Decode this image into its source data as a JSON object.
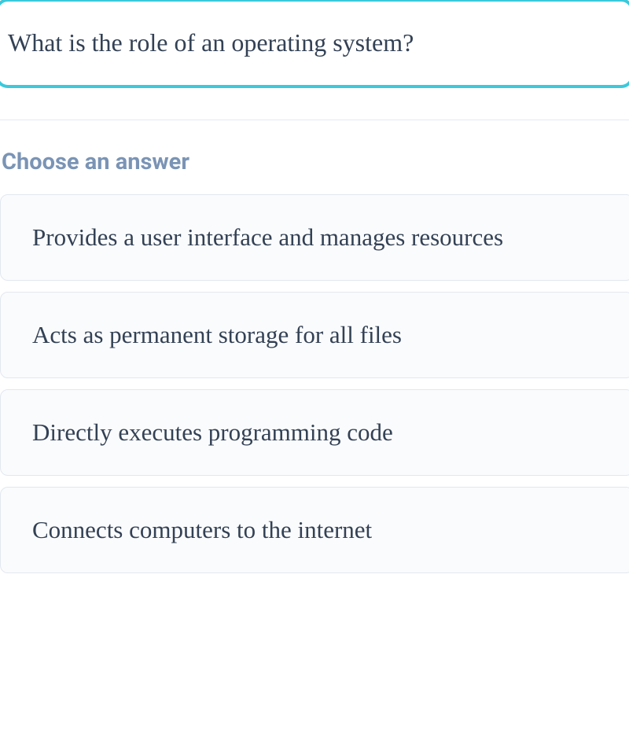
{
  "question": "What is the role of an operating system?",
  "choose_label": "Choose an answer",
  "answers": [
    "Provides a user interface and manages resources",
    "Acts as permanent storage for all files",
    "Directly executes programming code",
    "Connects computers to the internet"
  ]
}
